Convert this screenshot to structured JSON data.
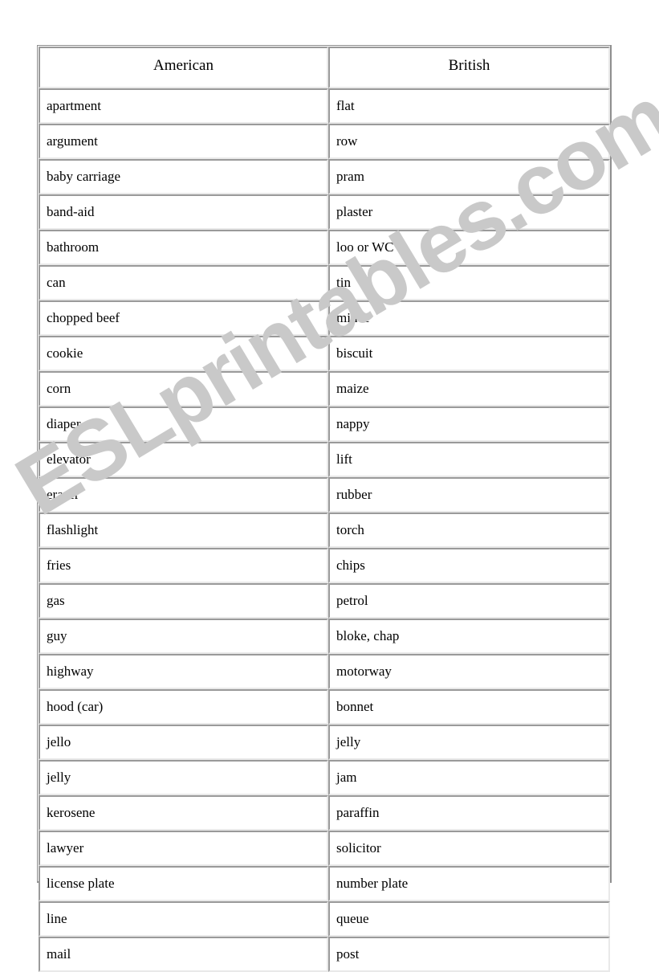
{
  "document": {
    "watermark_text": "ESLprintables.com",
    "watermark_color": "#c9c9c9",
    "border_color": "#9a9a9a",
    "text_color": "#000000",
    "background_color": "#ffffff"
  },
  "table": {
    "headers": {
      "american": "American",
      "british": "British"
    },
    "rows": [
      {
        "american": "apartment",
        "british": "flat"
      },
      {
        "american": "argument",
        "british": "row"
      },
      {
        "american": "baby carriage",
        "british": "pram"
      },
      {
        "american": "band-aid",
        "british": "plaster"
      },
      {
        "american": "bathroom",
        "british": "loo or WC"
      },
      {
        "american": "can",
        "british": "tin"
      },
      {
        "american": "chopped beef",
        "british": "mince"
      },
      {
        "american": "cookie",
        "british": "biscuit"
      },
      {
        "american": "corn",
        "british": "maize"
      },
      {
        "american": "diaper",
        "british": "nappy"
      },
      {
        "american": "elevator",
        "british": "lift"
      },
      {
        "american": "eraser",
        "british": "rubber"
      },
      {
        "american": "flashlight",
        "british": "torch"
      },
      {
        "american": "fries",
        "british": "chips"
      },
      {
        "american": "gas",
        "british": "petrol"
      },
      {
        "american": "guy",
        "british": "bloke, chap"
      },
      {
        "american": "highway",
        "british": "motorway"
      },
      {
        "american": "hood (car)",
        "british": "bonnet"
      },
      {
        "american": "jello",
        "british": "jelly"
      },
      {
        "american": "jelly",
        "british": "jam"
      },
      {
        "american": "kerosene",
        "british": "paraffin"
      },
      {
        "american": "lawyer",
        "british": "solicitor"
      },
      {
        "american": "license plate",
        "british": "number plate"
      },
      {
        "american": "line",
        "british": "queue"
      },
      {
        "american": "mail",
        "british": "post"
      }
    ]
  }
}
